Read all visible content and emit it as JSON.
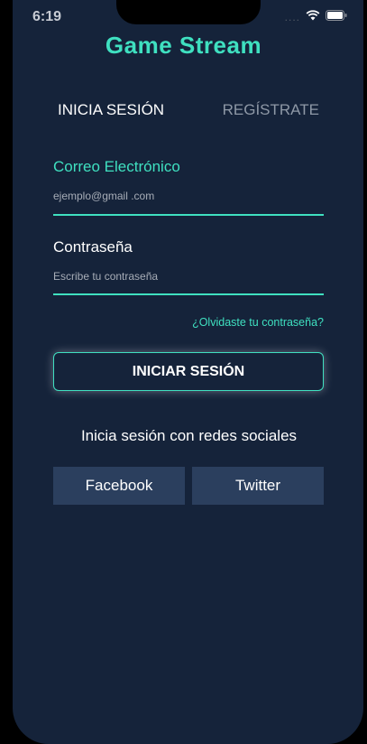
{
  "status_bar": {
    "time": "6:19",
    "dots": "....",
    "wifi_icon": "wifi-icon",
    "battery_icon": "battery-icon"
  },
  "app": {
    "title": "Game Stream",
    "accent_color": "#3fe0c0",
    "background_color": "#15233a"
  },
  "tabs": {
    "login_label": "INICIA SESIÓN",
    "register_label": "REGÍSTRATE"
  },
  "form": {
    "email_label": "Correo Electrónico",
    "email_placeholder": "ejemplo@gmail .com",
    "email_value": "",
    "password_label": "Contraseña",
    "password_placeholder": "Escribe tu contraseña",
    "password_value": "",
    "forgot_password": "¿Olvidaste tu contraseña?",
    "submit_label": "INICIAR SESIÓN"
  },
  "social": {
    "heading": "Inicia sesión con redes sociales",
    "facebook_label": "Facebook",
    "twitter_label": "Twitter",
    "button_color": "#2b3f5e"
  }
}
